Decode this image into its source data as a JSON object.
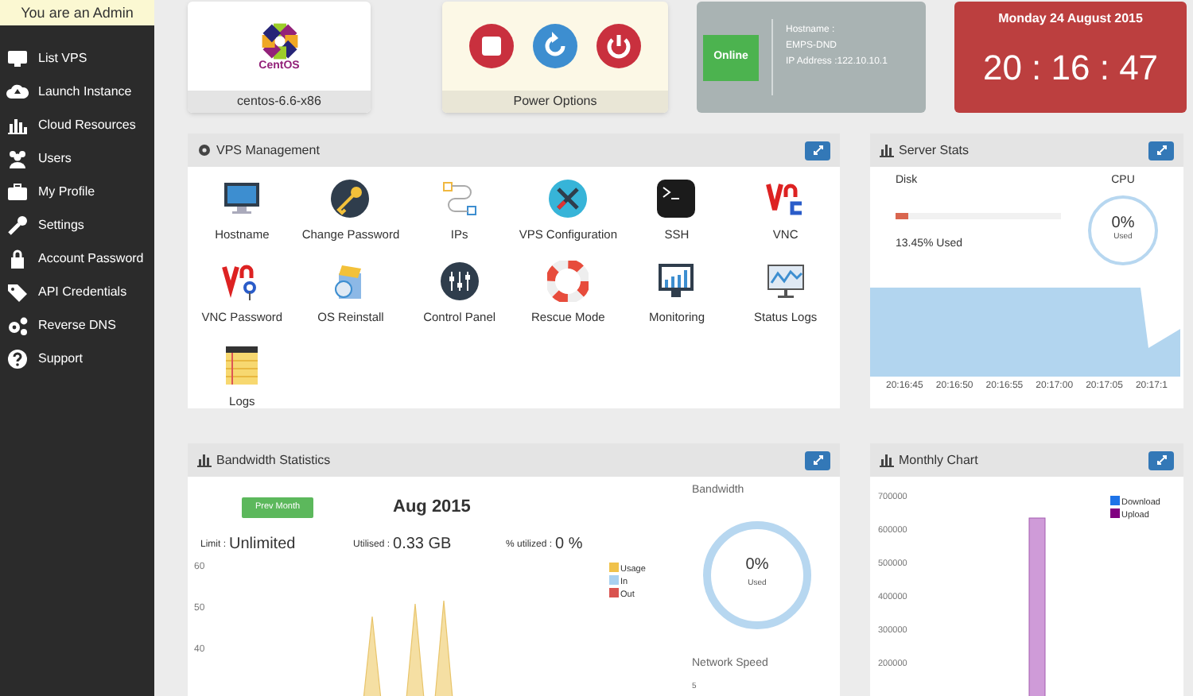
{
  "admin_banner": "You are an Admin",
  "sidebar": {
    "items": [
      {
        "label": "List VPS"
      },
      {
        "label": "Launch Instance"
      },
      {
        "label": "Cloud Resources"
      },
      {
        "label": "Users"
      },
      {
        "label": "My Profile"
      },
      {
        "label": "Settings"
      },
      {
        "label": "Account Password"
      },
      {
        "label": "API Credentials"
      },
      {
        "label": "Reverse DNS"
      },
      {
        "label": "Support"
      }
    ]
  },
  "os_card": {
    "logo_text": "CentOS",
    "name": "centos-6.6-x86"
  },
  "power_card": {
    "title": "Power Options"
  },
  "status_card": {
    "badge": "Online",
    "lines": [
      "Hostname :",
      "EMPS-DND",
      "IP Address :122.10.10.1"
    ]
  },
  "clock_card": {
    "date": "Monday 24 August 2015",
    "time": "20 : 16 : 47"
  },
  "vps_management": {
    "title": "VPS Management",
    "items": [
      "Hostname",
      "Change Password",
      "IPs",
      "VPS Configuration",
      "SSH",
      "VNC",
      "VNC Password",
      "OS Reinstall",
      "Control Panel",
      "Rescue Mode",
      "Monitoring",
      "Status Logs",
      "Logs"
    ]
  },
  "server_stats": {
    "title": "Server Stats",
    "disk_label": "Disk",
    "disk": {
      "level": 0.08
    },
    "disk_reading": "13.45% Used",
    "cpu_label": "CPU",
    "cpu_value": "0%",
    "cpu_caption": "Used",
    "time_labels": [
      "20:16:45",
      "20:16:50",
      "20:16:55",
      "20:17:00",
      "20:17:05",
      "20:17:1"
    ]
  },
  "bandwidth": {
    "title": "Bandwidth Statistics",
    "prev_button": "Prev Month",
    "month": "Aug 2015",
    "limit_label": "Limit :",
    "limit": "Unlimited",
    "utilised_label": "Utilised :",
    "utilised": "0.33 GB",
    "pct_label": "% utilized :",
    "pct": "0 %",
    "y_axis_labels": [
      "60",
      "50",
      "40"
    ],
    "legend": [
      {
        "label": "Usage",
        "color": "#f0c24b"
      },
      {
        "label": "In",
        "color": "#a8d0f0"
      },
      {
        "label": "Out",
        "color": "#d9534f"
      }
    ],
    "gauge_title": "Bandwidth",
    "gauge_value": "0%",
    "gauge_caption": "Used",
    "speed_title": "Network Speed",
    "speed_tick": "5"
  },
  "monthly": {
    "title": "Monthly Chart",
    "y_axis_labels": [
      "700000",
      "600000",
      "500000",
      "400000",
      "300000",
      "200000"
    ],
    "legend": [
      {
        "label": "Download",
        "color": "#1e73e8"
      },
      {
        "label": "Upload",
        "color": "#800080"
      }
    ]
  }
}
